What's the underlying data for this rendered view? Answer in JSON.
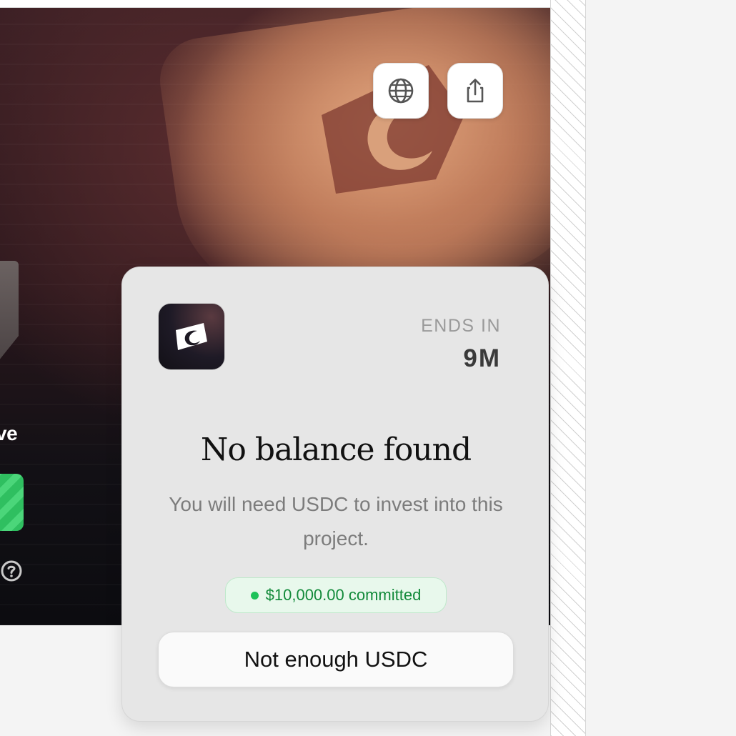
{
  "hero": {
    "text_fragment": "ve",
    "help_icon": "question-circle-icon"
  },
  "actions": {
    "globe_icon": "globe-icon",
    "share_icon": "share-icon"
  },
  "card": {
    "ends_label": "ENDS IN",
    "ends_value": "9M",
    "title": "No balance found",
    "subtitle": "You will need USDC to invest into this project.",
    "committed": "$10,000.00 committed",
    "cta_label": "Not enough USDC"
  },
  "colors": {
    "card_bg": "#e6e6e6",
    "committed_green": "#128a3a",
    "hero_green": "#2fbf60"
  }
}
